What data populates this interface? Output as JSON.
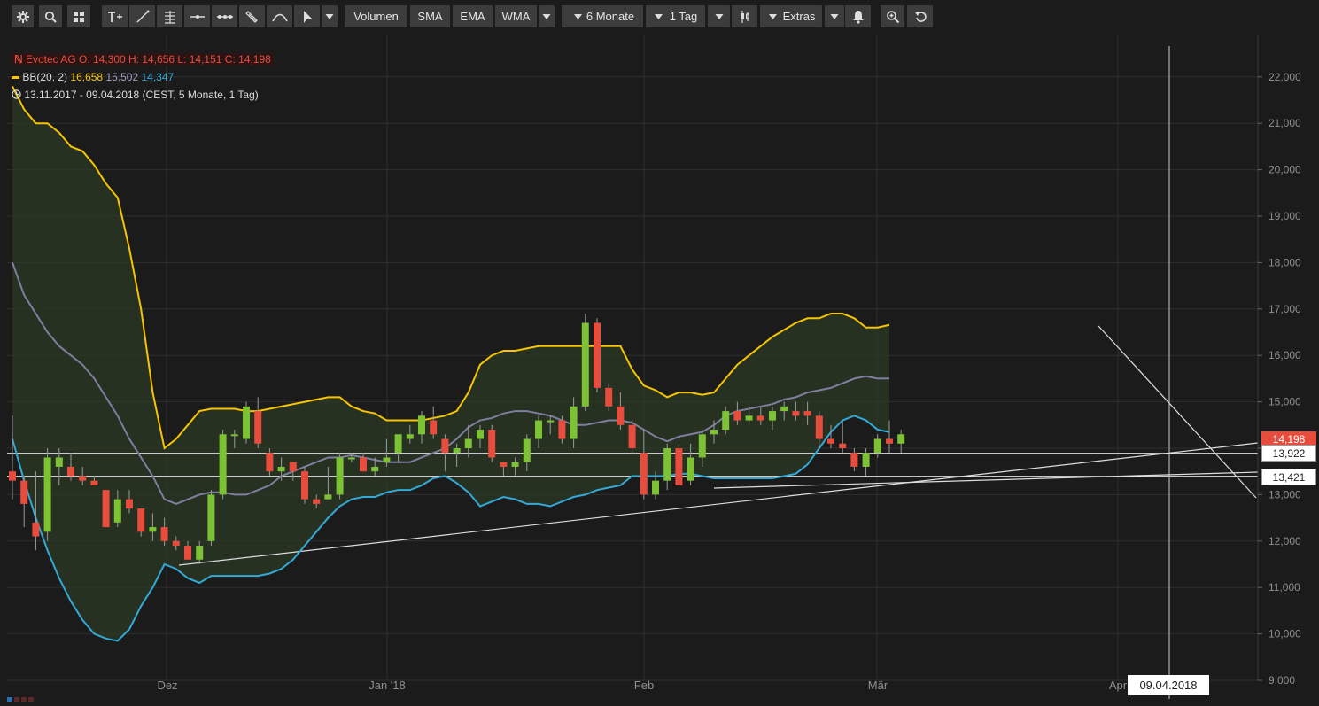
{
  "toolbar": {
    "volume_label": "Volumen",
    "sma_label": "SMA",
    "ema_label": "EMA",
    "wma_label": "WMA",
    "period_label": "6 Monate",
    "interval_label": "1 Tag",
    "extras_label": "Extras"
  },
  "legend": {
    "ohlc_text": "Evotec AG  O: 14,300  H: 14,656  L: 14,151  C: 14,198",
    "bb_name": "BB(20, 2)",
    "bb_upper": "16,658",
    "bb_mid": "15,502",
    "bb_lower": "14,347",
    "range_text": "13.11.2017 - 09.04.2018   (CEST, 5 Monate, 1 Tag)"
  },
  "labels": {
    "last_price": "14,198",
    "line1": "13,922",
    "line2": "13,421",
    "crosshair_date": "09.04.2018"
  },
  "colors": {
    "background": "#1b1b1b",
    "up": "#7cc234",
    "down": "#e84c3d",
    "bb_upper": "#f6c400",
    "bb_mid": "#7e7e9e",
    "bb_lower": "#33a9d6",
    "band_fill": "#2c3a24",
    "grid": "#2f2f2f",
    "lines": "#ffffff"
  },
  "chart_data": {
    "type": "candlestick",
    "title": "Evotec AG",
    "yaxis_ticks": [
      "9,000",
      "10,000",
      "11,000",
      "12,000",
      "13,000",
      "14,000",
      "15,000",
      "16,000",
      "17,000",
      "18,000",
      "19,000",
      "20,000",
      "21,000",
      "22,000"
    ],
    "ylim": [
      9,
      22.4
    ],
    "xaxis_labels": [
      "Dez",
      "Jan '18",
      "Feb",
      "Mär",
      "Apr"
    ],
    "bollinger_upper": [
      21.8,
      21.3,
      21.0,
      21.0,
      20.8,
      20.5,
      20.4,
      20.1,
      19.7,
      19.4,
      18.3,
      17.0,
      15.2,
      14.0,
      14.2,
      14.5,
      14.8,
      14.85,
      14.85,
      14.85,
      14.8,
      14.8,
      14.85,
      14.9,
      14.95,
      15.0,
      15.05,
      15.1,
      15.1,
      14.9,
      14.8,
      14.75,
      14.6,
      14.6,
      14.6,
      14.6,
      14.65,
      14.7,
      14.8,
      15.2,
      15.8,
      16.0,
      16.1,
      16.1,
      16.15,
      16.2,
      16.2,
      16.2,
      16.2,
      16.2,
      16.2,
      16.2,
      16.2,
      15.7,
      15.35,
      15.25,
      15.1,
      15.2,
      15.2,
      15.15,
      15.2,
      15.5,
      15.8,
      16.0,
      16.2,
      16.4,
      16.55,
      16.7,
      16.8,
      16.8,
      16.9,
      16.9,
      16.8,
      16.6,
      16.6,
      16.658
    ],
    "bollinger_mid": [
      18.0,
      17.3,
      16.9,
      16.5,
      16.2,
      16.0,
      15.8,
      15.5,
      15.1,
      14.7,
      14.2,
      13.8,
      13.4,
      12.9,
      12.8,
      12.9,
      13.0,
      13.05,
      13.05,
      13.0,
      13.0,
      13.1,
      13.2,
      13.4,
      13.5,
      13.6,
      13.7,
      13.8,
      13.8,
      13.85,
      13.8,
      13.75,
      13.7,
      13.7,
      13.7,
      13.8,
      13.9,
      14.0,
      14.2,
      14.45,
      14.6,
      14.65,
      14.75,
      14.8,
      14.8,
      14.75,
      14.7,
      14.6,
      14.5,
      14.5,
      14.55,
      14.6,
      14.6,
      14.55,
      14.4,
      14.25,
      14.15,
      14.25,
      14.3,
      14.35,
      14.5,
      14.7,
      14.8,
      14.85,
      14.9,
      14.95,
      15.05,
      15.1,
      15.2,
      15.25,
      15.3,
      15.4,
      15.5,
      15.55,
      15.5,
      15.502
    ],
    "bollinger_lower": [
      14.2,
      13.3,
      12.5,
      11.8,
      11.2,
      10.7,
      10.3,
      10.0,
      9.9,
      9.85,
      10.1,
      10.6,
      11.0,
      11.5,
      11.4,
      11.2,
      11.1,
      11.25,
      11.25,
      11.25,
      11.25,
      11.25,
      11.3,
      11.4,
      11.6,
      11.9,
      12.2,
      12.5,
      12.75,
      12.9,
      12.95,
      12.95,
      13.05,
      13.1,
      13.1,
      13.2,
      13.35,
      13.4,
      13.25,
      13.05,
      12.75,
      12.85,
      12.95,
      12.9,
      12.8,
      12.8,
      12.75,
      12.85,
      12.95,
      13.0,
      13.1,
      13.15,
      13.2,
      13.4,
      13.4,
      13.4,
      13.4,
      13.45,
      13.45,
      13.4,
      13.35,
      13.35,
      13.35,
      13.35,
      13.35,
      13.35,
      13.4,
      13.45,
      13.65,
      14.0,
      14.35,
      14.6,
      14.7,
      14.6,
      14.4,
      14.347
    ],
    "candles": [
      {
        "o": 13.5,
        "h": 14.7,
        "l": 12.9,
        "c": 13.3
      },
      {
        "o": 13.3,
        "h": 13.4,
        "l": 12.3,
        "c": 12.8
      },
      {
        "o": 12.4,
        "h": 13.5,
        "l": 11.8,
        "c": 12.1
      },
      {
        "o": 12.2,
        "h": 14.0,
        "l": 12.0,
        "c": 13.8
      },
      {
        "o": 13.6,
        "h": 14.0,
        "l": 13.2,
        "c": 13.8
      },
      {
        "o": 13.6,
        "h": 13.9,
        "l": 13.3,
        "c": 13.4
      },
      {
        "o": 13.4,
        "h": 13.6,
        "l": 13.2,
        "c": 13.3
      },
      {
        "o": 13.3,
        "h": 13.4,
        "l": 13.2,
        "c": 13.2
      },
      {
        "o": 13.1,
        "h": 13.1,
        "l": 12.3,
        "c": 12.3
      },
      {
        "o": 12.4,
        "h": 13.1,
        "l": 12.3,
        "c": 12.9
      },
      {
        "o": 12.9,
        "h": 13.1,
        "l": 12.6,
        "c": 12.7
      },
      {
        "o": 12.7,
        "h": 12.7,
        "l": 12.1,
        "c": 12.2
      },
      {
        "o": 12.2,
        "h": 12.6,
        "l": 12.0,
        "c": 12.3
      },
      {
        "o": 12.3,
        "h": 12.5,
        "l": 11.9,
        "c": 12.0
      },
      {
        "o": 12.0,
        "h": 12.1,
        "l": 11.8,
        "c": 11.9
      },
      {
        "o": 11.9,
        "h": 12.0,
        "l": 11.6,
        "c": 11.6
      },
      {
        "o": 11.6,
        "h": 12.0,
        "l": 11.5,
        "c": 11.9
      },
      {
        "o": 12.0,
        "h": 13.1,
        "l": 11.9,
        "c": 13.0
      },
      {
        "o": 13.0,
        "h": 14.4,
        "l": 12.9,
        "c": 14.3
      },
      {
        "o": 14.3,
        "h": 14.4,
        "l": 14.0,
        "c": 14.3
      },
      {
        "o": 14.2,
        "h": 15.0,
        "l": 14.1,
        "c": 14.9
      },
      {
        "o": 14.8,
        "h": 15.1,
        "l": 14.0,
        "c": 14.1
      },
      {
        "o": 13.9,
        "h": 14.0,
        "l": 13.4,
        "c": 13.5
      },
      {
        "o": 13.5,
        "h": 13.8,
        "l": 13.3,
        "c": 13.6
      },
      {
        "o": 13.7,
        "h": 13.7,
        "l": 13.3,
        "c": 13.5
      },
      {
        "o": 13.5,
        "h": 13.6,
        "l": 12.8,
        "c": 12.9
      },
      {
        "o": 12.9,
        "h": 13.0,
        "l": 12.7,
        "c": 12.8
      },
      {
        "o": 12.9,
        "h": 13.6,
        "l": 12.9,
        "c": 13.0
      },
      {
        "o": 13.0,
        "h": 13.9,
        "l": 12.9,
        "c": 13.8
      },
      {
        "o": 13.8,
        "h": 13.9,
        "l": 13.7,
        "c": 13.8
      },
      {
        "o": 13.8,
        "h": 13.9,
        "l": 13.5,
        "c": 13.5
      },
      {
        "o": 13.5,
        "h": 13.8,
        "l": 13.4,
        "c": 13.6
      },
      {
        "o": 13.7,
        "h": 14.2,
        "l": 13.6,
        "c": 13.8
      },
      {
        "o": 13.9,
        "h": 14.3,
        "l": 13.7,
        "c": 14.3
      },
      {
        "o": 14.2,
        "h": 14.5,
        "l": 14.1,
        "c": 14.3
      },
      {
        "o": 14.3,
        "h": 14.8,
        "l": 14.1,
        "c": 14.7
      },
      {
        "o": 14.6,
        "h": 14.9,
        "l": 14.2,
        "c": 14.3
      },
      {
        "o": 14.2,
        "h": 14.3,
        "l": 13.5,
        "c": 13.9
      },
      {
        "o": 13.9,
        "h": 14.1,
        "l": 13.6,
        "c": 14.0
      },
      {
        "o": 14.0,
        "h": 14.5,
        "l": 13.8,
        "c": 14.2
      },
      {
        "o": 14.2,
        "h": 14.5,
        "l": 14.0,
        "c": 14.4
      },
      {
        "o": 14.4,
        "h": 14.5,
        "l": 13.7,
        "c": 13.8
      },
      {
        "o": 13.7,
        "h": 13.7,
        "l": 13.4,
        "c": 13.6
      },
      {
        "o": 13.6,
        "h": 13.8,
        "l": 13.4,
        "c": 13.7
      },
      {
        "o": 13.7,
        "h": 14.3,
        "l": 13.5,
        "c": 14.2
      },
      {
        "o": 14.2,
        "h": 14.7,
        "l": 14.0,
        "c": 14.6
      },
      {
        "o": 14.6,
        "h": 14.7,
        "l": 14.3,
        "c": 14.6
      },
      {
        "o": 14.6,
        "h": 14.7,
        "l": 14.1,
        "c": 14.2
      },
      {
        "o": 14.2,
        "h": 15.1,
        "l": 14.0,
        "c": 14.9
      },
      {
        "o": 14.9,
        "h": 16.9,
        "l": 14.8,
        "c": 16.7
      },
      {
        "o": 16.7,
        "h": 16.8,
        "l": 15.2,
        "c": 15.3
      },
      {
        "o": 15.3,
        "h": 15.4,
        "l": 14.8,
        "c": 14.9
      },
      {
        "o": 14.9,
        "h": 15.2,
        "l": 14.4,
        "c": 14.5
      },
      {
        "o": 14.5,
        "h": 14.6,
        "l": 13.9,
        "c": 14.0
      },
      {
        "o": 13.9,
        "h": 14.4,
        "l": 12.9,
        "c": 13.0
      },
      {
        "o": 13.0,
        "h": 13.5,
        "l": 12.9,
        "c": 13.3
      },
      {
        "o": 13.3,
        "h": 14.1,
        "l": 13.1,
        "c": 14.0
      },
      {
        "o": 14.0,
        "h": 14.1,
        "l": 13.2,
        "c": 13.2
      },
      {
        "o": 13.3,
        "h": 14.1,
        "l": 13.2,
        "c": 13.8
      },
      {
        "o": 13.8,
        "h": 14.4,
        "l": 13.6,
        "c": 14.3
      },
      {
        "o": 14.3,
        "h": 14.6,
        "l": 14.1,
        "c": 14.4
      },
      {
        "o": 14.4,
        "h": 14.9,
        "l": 14.3,
        "c": 14.8
      },
      {
        "o": 14.8,
        "h": 15.0,
        "l": 14.5,
        "c": 14.6
      },
      {
        "o": 14.6,
        "h": 14.9,
        "l": 14.5,
        "c": 14.7
      },
      {
        "o": 14.7,
        "h": 14.9,
        "l": 14.5,
        "c": 14.6
      },
      {
        "o": 14.6,
        "h": 14.9,
        "l": 14.4,
        "c": 14.8
      },
      {
        "o": 14.8,
        "h": 15.0,
        "l": 14.6,
        "c": 14.9
      },
      {
        "o": 14.8,
        "h": 15.0,
        "l": 14.6,
        "c": 14.7
      },
      {
        "o": 14.8,
        "h": 15.0,
        "l": 14.5,
        "c": 14.7
      },
      {
        "o": 14.7,
        "h": 14.8,
        "l": 14.0,
        "c": 14.2
      },
      {
        "o": 14.2,
        "h": 14.5,
        "l": 14.0,
        "c": 14.1
      },
      {
        "o": 14.1,
        "h": 14.6,
        "l": 13.9,
        "c": 14.0
      },
      {
        "o": 13.9,
        "h": 14.0,
        "l": 13.5,
        "c": 13.6
      },
      {
        "o": 13.6,
        "h": 14.0,
        "l": 13.4,
        "c": 13.9
      },
      {
        "o": 13.9,
        "h": 14.3,
        "l": 13.8,
        "c": 14.2
      },
      {
        "o": 14.2,
        "h": 14.6,
        "l": 13.9,
        "c": 14.1
      },
      {
        "o": 14.1,
        "h": 14.4,
        "l": 13.9,
        "c": 14.3
      }
    ]
  }
}
